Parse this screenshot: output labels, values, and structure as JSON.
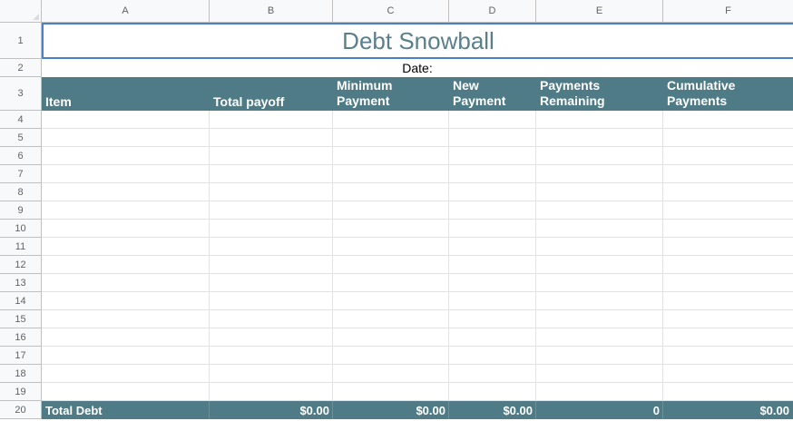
{
  "columns": [
    "A",
    "B",
    "C",
    "D",
    "E",
    "F"
  ],
  "rows": [
    "1",
    "2",
    "3",
    "4",
    "5",
    "6",
    "7",
    "8",
    "9",
    "10",
    "11",
    "12",
    "13",
    "14",
    "15",
    "16",
    "17",
    "18",
    "19",
    "20"
  ],
  "title": "Debt Snowball",
  "date_label": "Date:",
  "headers": {
    "item": "Item",
    "total_payoff": "Total payoff",
    "min_payment_1": "Minimum",
    "min_payment_2": "Payment",
    "new_payment_1": "New",
    "new_payment_2": "Payment",
    "payments_remaining_1": "Payments",
    "payments_remaining_2": "Remaining",
    "cumulative_1": "Cumulative",
    "cumulative_2": "Payments"
  },
  "totals": {
    "label": "Total Debt",
    "total_payoff": "$0.00",
    "min_payment": "$0.00",
    "new_payment": "$0.00",
    "payments_remaining": "0",
    "cumulative": "$0.00"
  }
}
